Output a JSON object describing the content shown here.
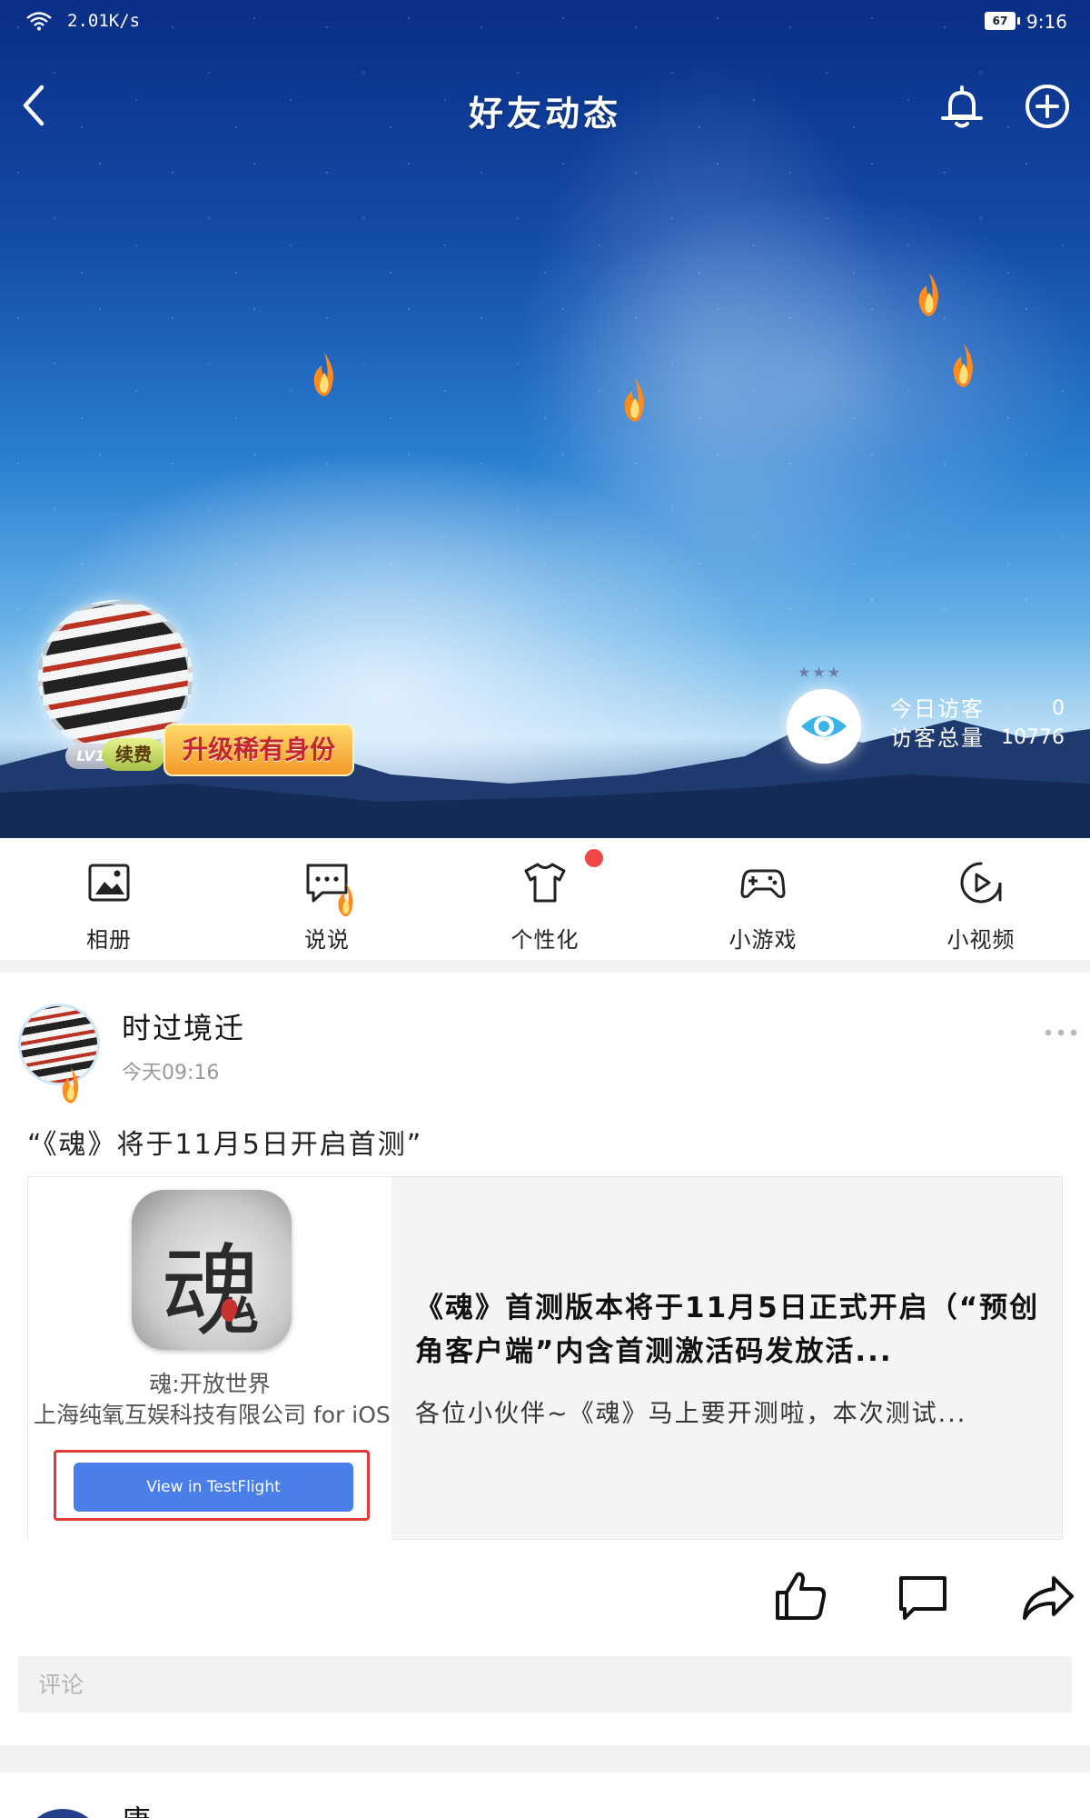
{
  "status_bar": {
    "network_speed": "2.01K/s",
    "battery": "67",
    "time": "9:16"
  },
  "nav": {
    "title": "好友动态"
  },
  "profile": {
    "level": "LV1",
    "renew_label": "续费",
    "upgrade_label": "升级稀有身份",
    "visitors_today_label": "今日访客",
    "visitors_today_value": "0",
    "visitors_total_label": "访客总量",
    "visitors_total_value": "10776"
  },
  "quick_nav": [
    {
      "label": "相册",
      "icon": "image-icon"
    },
    {
      "label": "说说",
      "icon": "speech-bubble-icon"
    },
    {
      "label": "个性化",
      "icon": "tshirt-icon"
    },
    {
      "label": "小游戏",
      "icon": "gamepad-icon"
    },
    {
      "label": "小视频",
      "icon": "play-circle-icon"
    }
  ],
  "post": {
    "author": "时过境迁",
    "time": "今天09:16",
    "text": "“《魂》将于11月5日开启首测”",
    "share": {
      "app_icon_glyph": "魂",
      "app_name": "魂:开放世界",
      "app_company": "上海纯氧互娱科技有限公司 for iOS",
      "button_label": "View in TestFlight",
      "title": "《魂》首测版本将于11月5日正式开启（“预创角客户端”内含首测激活码发放活...",
      "description": "各位小伙伴~《魂》马上要开测啦，本次测试..."
    },
    "comment_placeholder": "评论"
  },
  "next_post": {
    "author": "唐"
  },
  "colors": {
    "accent_blue": "#4a7ee8",
    "red_dot": "#f04848",
    "frame_red": "#e23a3a"
  }
}
